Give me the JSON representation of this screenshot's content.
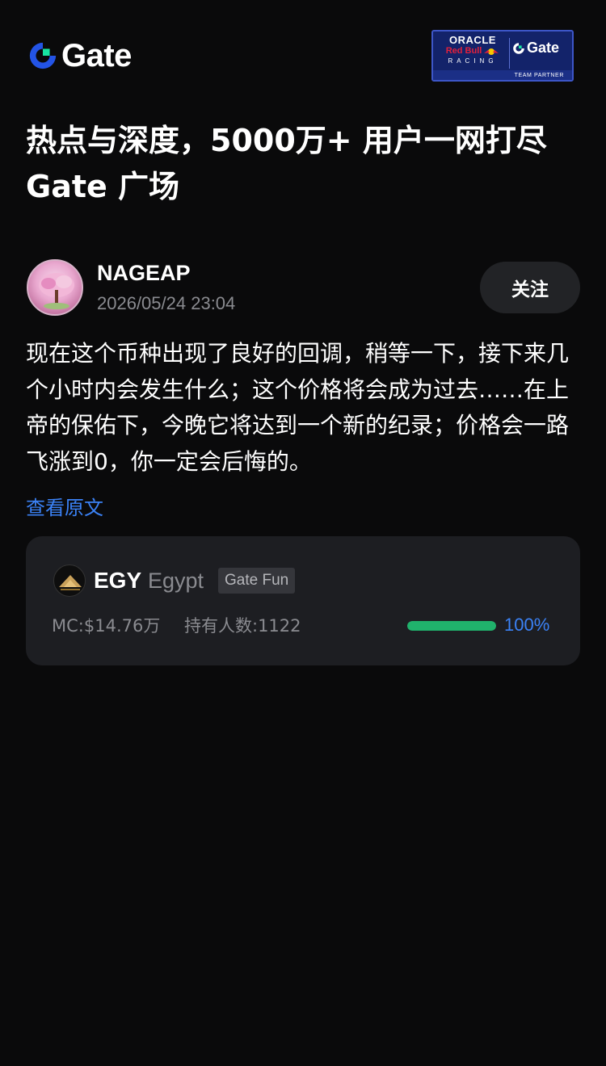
{
  "header": {
    "brand_name": "Gate",
    "partner": {
      "line1": "ORACLE",
      "line2": "Red Bull",
      "line3": "RACING",
      "brand": "Gate",
      "caption": "TEAM PARTNER"
    }
  },
  "headline": "热点与深度，5000万+ 用户一网打尽 Gate 广场",
  "post": {
    "author": "NAGEAP",
    "timestamp": "2026/05/24 23:04",
    "follow_label": "关注",
    "body": "现在这个币种出现了良好的回调，稍等一下，接下来几个小时内会发生什么；这个价格将会成为过去……在上帝的保佑下，今晚它将达到一个新的纪录；价格会一路飞涨到0，你一定会后悔的。",
    "view_original_label": "查看原文"
  },
  "token": {
    "symbol": "EGY",
    "name": "Egypt",
    "tag": "Gate Fun",
    "market_cap": "MC:$14.76万",
    "holders": "持有人数:1122",
    "progress_value": 1.0,
    "progress_label": "100%"
  },
  "colors": {
    "background": "#0a0a0b",
    "accent_blue": "#3b82f6",
    "progress_green": "#20b26c",
    "card_bg": "#1d1e22",
    "muted_text": "#8a8b90"
  }
}
